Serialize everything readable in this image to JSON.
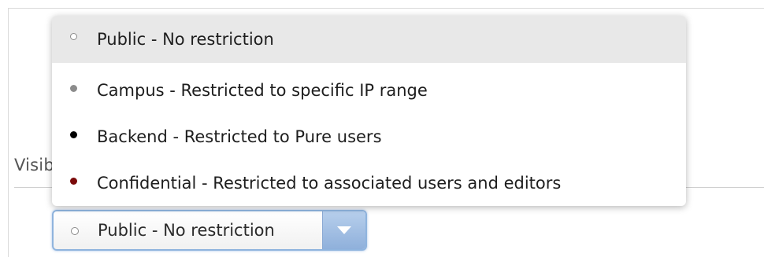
{
  "section": {
    "heading": "Visibility"
  },
  "visibility_select": {
    "selected_label": "Public - No restriction",
    "selected_dot_color": "#ffffff",
    "arrow_icon": "chevron-down-icon"
  },
  "dropdown": {
    "options": [
      {
        "label": "Public - No restriction",
        "dot_color": "#ffffff",
        "dot_border": "#8a8a8a",
        "selected": true
      },
      {
        "label": "Campus - Restricted to specific IP range",
        "dot_color": "#8c8c8c",
        "dot_border": "#8c8c8c",
        "selected": false
      },
      {
        "label": "Backend - Restricted to Pure users",
        "dot_color": "#000000",
        "dot_border": "#000000",
        "selected": false
      },
      {
        "label": "Confidential - Restricted to associated users and editors",
        "dot_color": "#7a0a0a",
        "dot_border": "#7a0a0a",
        "selected": false
      }
    ]
  },
  "colors": {
    "select_border": "#8fb4de",
    "arrow_button": "#9fbde3",
    "selected_row_bg": "#e8e8e8"
  }
}
